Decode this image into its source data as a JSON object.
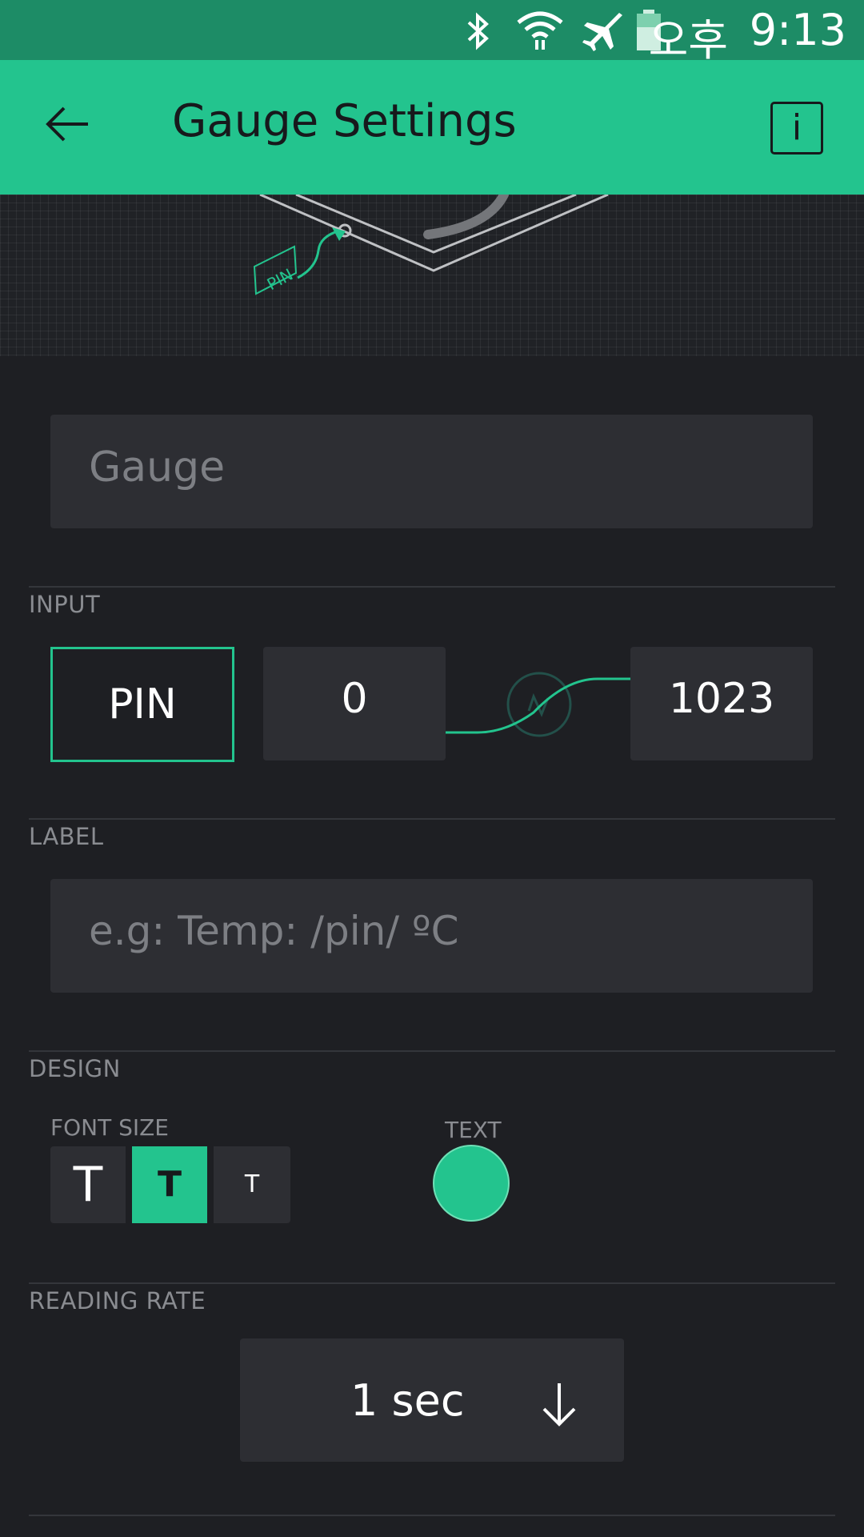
{
  "status_bar": {
    "locale_prefix": "오후",
    "time": "9:13",
    "icons": [
      "bluetooth-icon",
      "wifi-icon",
      "airplane-icon",
      "battery-icon"
    ]
  },
  "app_bar": {
    "title": "Gauge Settings",
    "info_label": "i"
  },
  "preview": {
    "pin_tag": "PIN"
  },
  "name_field": {
    "placeholder": "Gauge"
  },
  "input_section": {
    "title": "INPUT",
    "pin_label": "PIN",
    "min_value": "0",
    "max_value": "1023"
  },
  "label_section": {
    "title": "LABEL",
    "placeholder": "e.g: Temp: /pin/ ºC"
  },
  "design_section": {
    "title": "DESIGN",
    "font_size_label": "FONT SIZE",
    "font_size_options": [
      "T",
      "T",
      "T"
    ],
    "selected_font_size": "medium",
    "text_label": "TEXT",
    "text_color": "#23c48e"
  },
  "reading_rate_section": {
    "title": "READING RATE",
    "value": "1 sec"
  },
  "colors": {
    "accent": "#23c48e",
    "status_bar": "#1d8c66",
    "background": "#1e1f23",
    "field": "#2d2e33"
  }
}
